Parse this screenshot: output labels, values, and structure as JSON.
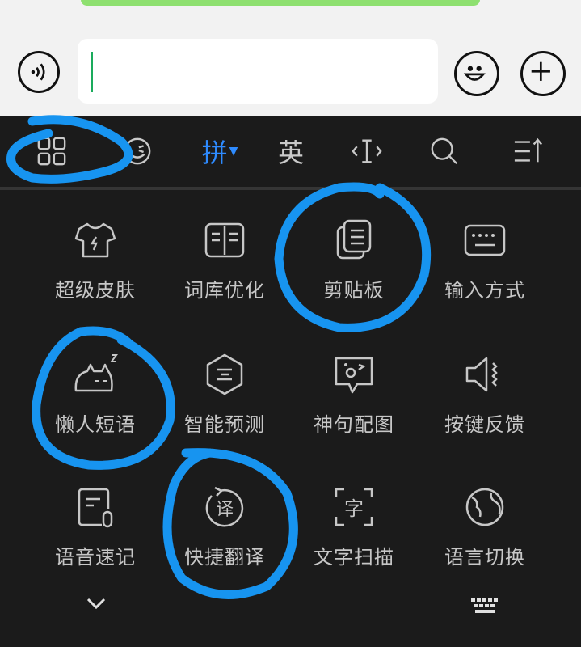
{
  "topbar": {
    "accent_green": "#1aab5c"
  },
  "toolbar": {
    "items": [
      {
        "name": "apps-grid-icon",
        "label": ""
      },
      {
        "name": "emoji-icon",
        "label": ""
      },
      {
        "name": "pinyin-tab",
        "label": "拼"
      },
      {
        "name": "english-tab",
        "label": "英"
      },
      {
        "name": "cursor-icon",
        "label": ""
      },
      {
        "name": "search-icon",
        "label": ""
      },
      {
        "name": "menu-icon",
        "label": ""
      }
    ],
    "active_color": "#2e8bff"
  },
  "features": [
    {
      "label": "超级皮肤",
      "icon": "shirt-icon"
    },
    {
      "label": "词库优化",
      "icon": "book-icon"
    },
    {
      "label": "剪贴板",
      "icon": "clipboard-icon"
    },
    {
      "label": "输入方式",
      "icon": "keyboard-icon"
    },
    {
      "label": "懒人短语",
      "icon": "lazy-cat-icon"
    },
    {
      "label": "智能预测",
      "icon": "predict-icon"
    },
    {
      "label": "神句配图",
      "icon": "picture-icon"
    },
    {
      "label": "按键反馈",
      "icon": "speaker-icon"
    },
    {
      "label": "语音速记",
      "icon": "voice-note-icon"
    },
    {
      "label": "快捷翻译",
      "icon": "translate-icon"
    },
    {
      "label": "文字扫描",
      "icon": "scan-icon"
    },
    {
      "label": "语言切换",
      "icon": "globe-icon"
    }
  ],
  "annotation_color": "#1794f0"
}
